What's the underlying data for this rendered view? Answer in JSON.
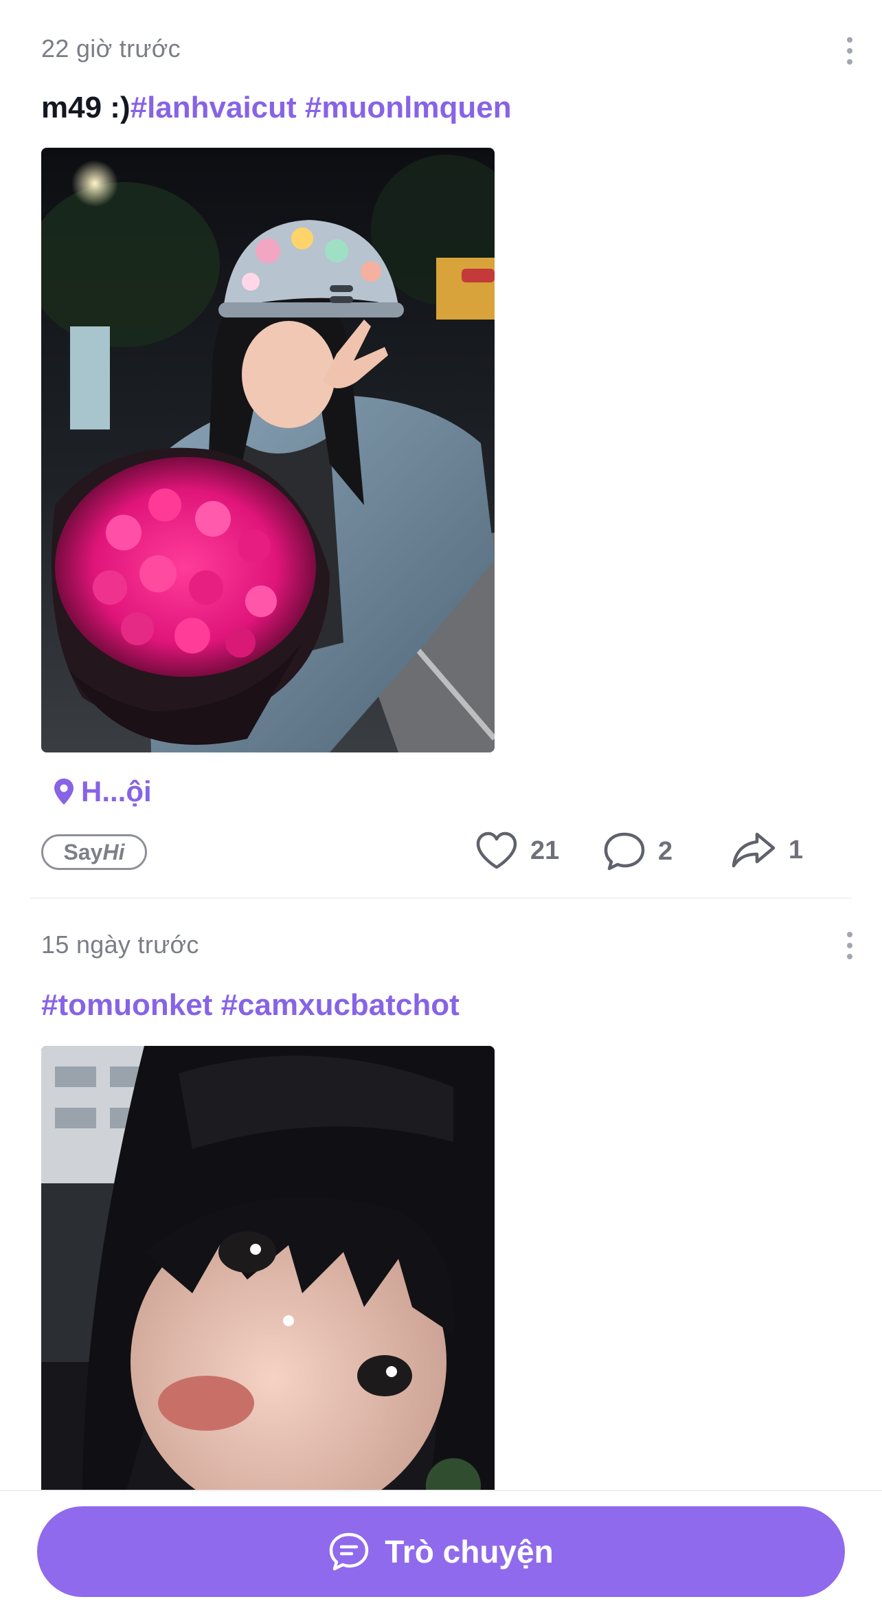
{
  "posts": [
    {
      "time": "22 giờ trước",
      "caption_text": "m49 :)",
      "hashtags": "#lanhvaicut #muonlmquen",
      "photo_description": "",
      "location": "H...ội",
      "sayhi_say": "Say",
      "sayhi_hi": "Hi",
      "likes": "21",
      "comments": "2",
      "shares": "1"
    },
    {
      "time": "15 ngày trước",
      "caption_text": "",
      "hashtags": "#tomuonket #camxucbatchot"
    }
  ],
  "bottom_bar": {
    "chat_label": "Trò chuyện"
  },
  "icons": {
    "more": "more-vertical-icon",
    "location": "location-pin-icon",
    "like": "heart-icon",
    "comment": "comment-bubble-icon",
    "share": "share-arrow-icon",
    "chat": "chat-bubble-icon"
  },
  "colors": {
    "accent": "#8763e6",
    "button": "#8f6aec",
    "muted_text": "#7a7d86",
    "caption_text": "#141720"
  }
}
